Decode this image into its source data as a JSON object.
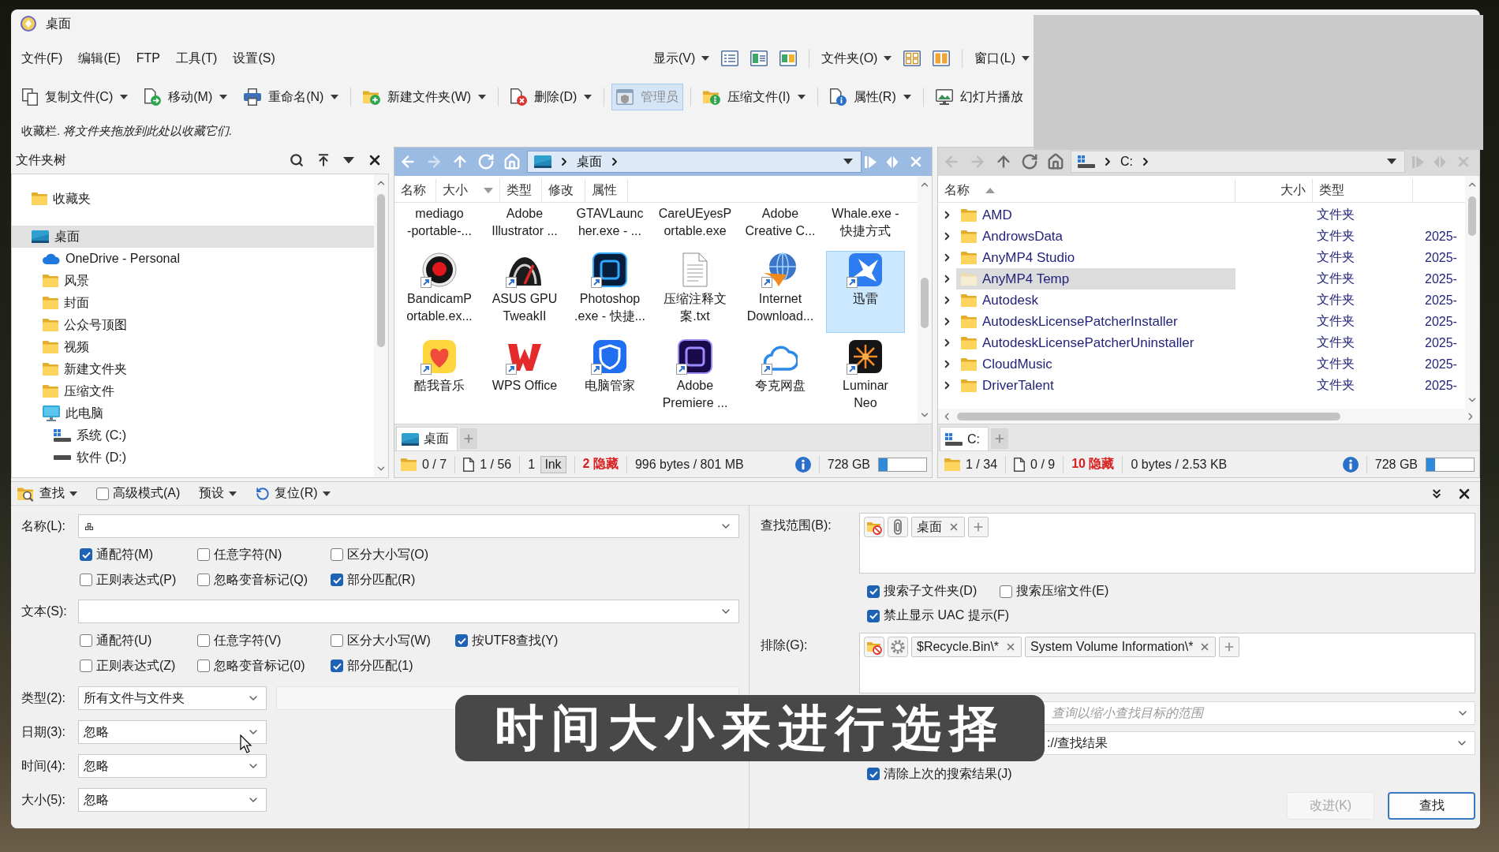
{
  "window": {
    "title": "桌面"
  },
  "menu": [
    "文件(F)",
    "编辑(E)",
    "FTP",
    "工具(T)",
    "设置(S)"
  ],
  "view_menus": [
    "显示(V)",
    "文件夹(O)",
    "窗口(L)"
  ],
  "toolbar": [
    {
      "label": "复制文件(C)",
      "menu": true,
      "pressed": false
    },
    {
      "label": "移动(M)",
      "menu": true,
      "pressed": false
    },
    {
      "label": "重命名(N)",
      "menu": true,
      "pressed": false
    },
    {
      "label": "新建文件夹(W)",
      "menu": true,
      "pressed": false
    },
    {
      "label": "删除(D)",
      "menu": true,
      "pressed": false
    },
    {
      "label": "管理员",
      "menu": false,
      "pressed": true
    },
    {
      "label": "压缩文件(I)",
      "menu": true,
      "pressed": false
    },
    {
      "label": "属性(R)",
      "menu": true,
      "pressed": false
    },
    {
      "label": "幻灯片播放",
      "menu": false,
      "pressed": false
    }
  ],
  "favorites_bar": "收藏栏. *将文件夹拖放到此处以收藏它们.*",
  "folder_tree": {
    "title": "文件夹树",
    "items": [
      {
        "label": "收藏夹",
        "kind": "folder",
        "selected": false
      },
      {
        "label": "桌面",
        "kind": "desktop",
        "selected": true,
        "children": [
          {
            "label": "OneDrive - Personal",
            "kind": "cloud",
            "selected": false
          },
          {
            "label": "风景",
            "kind": "folder",
            "selected": false
          },
          {
            "label": "封面",
            "kind": "folder",
            "selected": false
          },
          {
            "label": "公众号顶图",
            "kind": "folder",
            "selected": false
          },
          {
            "label": "视频",
            "kind": "folder",
            "selected": false
          },
          {
            "label": "新建文件夹",
            "kind": "folder",
            "selected": false
          },
          {
            "label": "压缩文件",
            "kind": "folder",
            "selected": false
          },
          {
            "label": "此电脑",
            "kind": "computer",
            "selected": false,
            "children": [
              {
                "label": "系统 (C:)",
                "kind": "system_drive",
                "selected": false
              },
              {
                "label": "软件 (D:)",
                "kind": "drive",
                "selected": false
              }
            ]
          }
        ]
      }
    ]
  },
  "left_pane": {
    "active": true,
    "back_enabled": true,
    "forward_enabled": false,
    "location": {
      "kind": "desktop",
      "path": "桌面"
    },
    "columns": [
      {
        "label": "名称",
        "kind": "plain"
      },
      {
        "label": "大小",
        "kind": "sort_desc"
      },
      {
        "label": "类型",
        "kind": "plain"
      },
      {
        "label": "修改",
        "kind": "plain"
      },
      {
        "label": "属性",
        "kind": "plain"
      }
    ],
    "cut_row": [
      "mediago\n-portable-...",
      "Adobe\nIllustrator ...",
      "GTAVLaunc\nher.exe - ...",
      "CareUEyesP\nortable.exe",
      "Adobe\nCreative C...",
      "Whale.exe -\n快捷方式"
    ],
    "items": [
      {
        "label": "BandicamP\nortable.ex...",
        "shortcut": true,
        "selected": false
      },
      {
        "label": "ASUS GPU\nTweakII",
        "shortcut": true,
        "selected": false
      },
      {
        "label": "Photoshop\n.exe - 快捷...",
        "shortcut": true,
        "selected": false
      },
      {
        "label": "压缩注释文案.txt",
        "shortcut": false,
        "selected": false
      },
      {
        "label": "Internet\nDownload...",
        "shortcut": true,
        "selected": false
      },
      {
        "label": "迅雷",
        "shortcut": true,
        "selected": true
      },
      {
        "label": "酷我音乐",
        "shortcut": true,
        "selected": false
      },
      {
        "label": "WPS Office",
        "shortcut": true,
        "selected": false
      },
      {
        "label": "电脑管家",
        "shortcut": true,
        "selected": false
      },
      {
        "label": "Adobe\nPremiere ...",
        "shortcut": true,
        "selected": false
      },
      {
        "label": "夸克网盘",
        "shortcut": true,
        "selected": false
      },
      {
        "label": "Luminar\nNeo",
        "shortcut": true,
        "selected": false
      }
    ],
    "tabs": [
      {
        "label": "桌面",
        "kind": "desktop",
        "selected": true
      }
    ],
    "status": {
      "folders": "0 / 7",
      "files": "1 / 56",
      "selected_count": "1",
      "selected_type": "lnk",
      "hidden": "2 隐藏",
      "size": "996 bytes / 801 MB",
      "free": "728 GB",
      "level": 0.19
    }
  },
  "right_pane": {
    "active": false,
    "back_enabled": false,
    "forward_enabled": false,
    "location": {
      "kind": "system_drive",
      "path": "C:"
    },
    "columns": [
      {
        "label": "名称",
        "kind": "sort_asc"
      },
      {
        "label": "大小",
        "kind": "plain"
      },
      {
        "label": "类型",
        "kind": "plain"
      }
    ],
    "rows": [
      {
        "name": "AMD",
        "type": "文件夹",
        "expanded": false,
        "selected": false
      },
      {
        "name": "AndrowsData",
        "type": "文件夹",
        "column_4": "2025-",
        "expanded": false,
        "selected": false
      },
      {
        "name": "AnyMP4 Studio",
        "type": "文件夹",
        "column_4": "2025-",
        "expanded": false,
        "selected": false
      },
      {
        "name": "AnyMP4 Temp",
        "type": "文件夹",
        "column_4": "2025-",
        "expanded": false,
        "selected": true
      },
      {
        "name": "Autodesk",
        "type": "文件夹",
        "column_4": "2025-",
        "expanded": false,
        "selected": false
      },
      {
        "name": "AutodeskLicensePatcherInstaller",
        "type": "文件夹",
        "column_4": "2025-",
        "expanded": false,
        "selected": false
      },
      {
        "name": "AutodeskLicensePatcherUninstaller",
        "type": "文件夹",
        "column_4": "2025-",
        "expanded": false,
        "selected": false
      },
      {
        "name": "CloudMusic",
        "type": "文件夹",
        "column_4": "2025-",
        "expanded": false,
        "selected": false
      },
      {
        "name": "DriverTalent",
        "type": "文件夹",
        "column_4": "2025-",
        "expanded": false,
        "selected": false
      }
    ],
    "tabs": [
      {
        "label": "C:",
        "kind": "system_drive",
        "selected": true
      }
    ],
    "status": {
      "folders": "1 / 34",
      "files": "0 / 9",
      "hidden": "10 隐藏",
      "size": "0 bytes / 2.53 KB",
      "free": "728 GB",
      "level": 0.19
    }
  },
  "search": {
    "toolbar": {
      "find": "查找",
      "advanced": {
        "label": "高级模式(A)",
        "checked": false
      },
      "preset": "预设",
      "reset": "复位(R)"
    },
    "name": {
      "label": "名称(L):",
      "options": [
        [
          {
            "label": "通配符(M)",
            "checked": true
          },
          {
            "label": "任意字符(N)",
            "checked": false
          },
          {
            "label": "区分大小写(O)",
            "checked": false
          }
        ],
        [
          {
            "label": "正则表达式(P)",
            "checked": false
          },
          {
            "label": "忽略变音标记(Q)",
            "checked": false
          },
          {
            "label": "部分匹配(R)",
            "checked": true
          }
        ]
      ]
    },
    "text": {
      "label": "文本(S):",
      "options": [
        [
          {
            "label": "通配符(U)",
            "checked": false
          },
          {
            "label": "任意字符(V)",
            "checked": false
          },
          {
            "label": "区分大小写(W)",
            "checked": false
          },
          {
            "label": "按UTF8查找(Y)",
            "checked": true
          }
        ],
        [
          {
            "label": "正则表达式(Z)",
            "checked": false
          },
          {
            "label": "忽略变音标记(0)",
            "checked": false
          },
          {
            "label": "部分匹配(1)",
            "checked": true
          }
        ]
      ]
    },
    "filters": [
      {
        "label": "类型(2):",
        "value": "所有文件与文件夹"
      },
      {
        "label": "日期(3):",
        "value": "忽略"
      },
      {
        "label": "时间(4):",
        "value": "忽略"
      },
      {
        "label": "大小(5):",
        "value": "忽略"
      }
    ],
    "scope": {
      "label": "查找范围(B):",
      "chips": [
        "桌面"
      ]
    },
    "scope_options": [
      [
        {
          "label": "搜索子文件夹(D)",
          "checked": true
        },
        {
          "label": "搜索压缩文件(E)",
          "checked": false
        }
      ],
      [
        {
          "label": "禁止显示 UAC 提示(F)",
          "checked": true
        }
      ]
    ],
    "exclude": {
      "label": "排除(G):",
      "chips": [
        "$Recycle.Bin\\*",
        "System Volume Information\\*"
      ]
    },
    "index_search": {
      "placeholder": "查询以缩小查找目标的范围"
    },
    "display": {
      "value": "://查找结果"
    },
    "clear_previous": {
      "label": "清除上次的搜索结果(J)",
      "checked": true
    },
    "buttons": [
      {
        "label": "改进(K)",
        "disabled": true,
        "default": false
      },
      {
        "label": "查找",
        "disabled": false,
        "default": true
      }
    ]
  },
  "caption": "时间大小来进行选择"
}
